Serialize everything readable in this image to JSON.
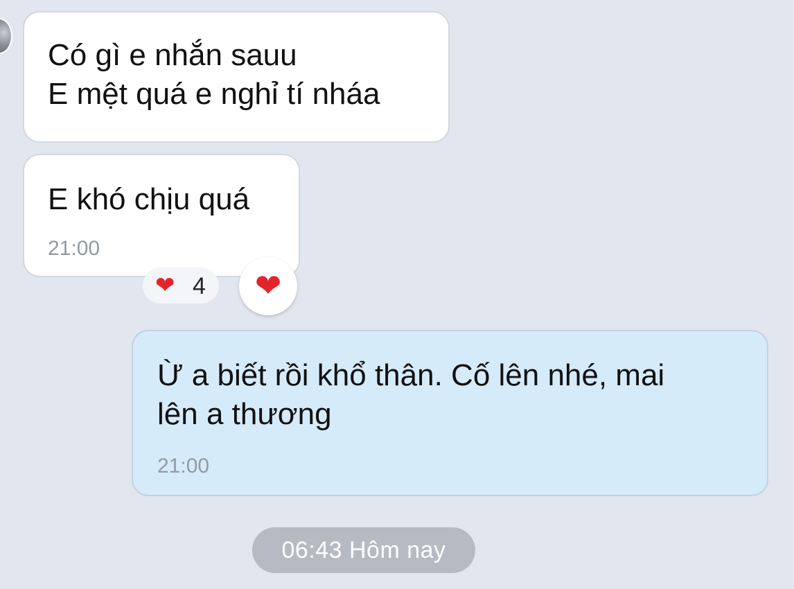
{
  "messages": [
    {
      "direction": "incoming",
      "text": "Có gì e nhắn sauu\nE mệt quá e nghỉ tí nháa",
      "time": ""
    },
    {
      "direction": "incoming",
      "text": "E khó chịu quá",
      "time": "21:00"
    },
    {
      "direction": "outgoing",
      "text": "Ừ a biết rồi khổ thân. Cố lên nhé, mai\nlên a thương",
      "time": "21:00"
    }
  ],
  "reaction": {
    "icon": "heart-icon",
    "emoji": "❤",
    "count": "4"
  },
  "react_button": {
    "icon": "heart-icon",
    "emoji": "❤"
  },
  "divider": {
    "label": "06:43 Hôm nay"
  },
  "colors": {
    "background": "#e2e6ee",
    "incoming_bubble": "#ffffff",
    "outgoing_bubble": "#d5ebfa",
    "heart": "#e3242b",
    "date_pill": "#b6bbc3"
  }
}
